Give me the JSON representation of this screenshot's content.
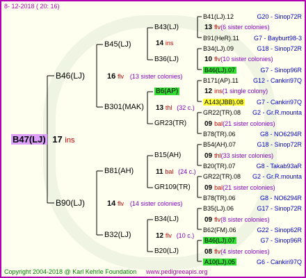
{
  "timestamp": "8- 12-2018 ( 20: 16)",
  "footer": {
    "copyright": "Copyright 2004-2018 @ Karl Kehrle Foundation",
    "url": "www.pedigreeapis.org"
  },
  "root": {
    "label": "B47(LJ)",
    "num": "17",
    "tag": "ins"
  },
  "g1": [
    {
      "label": "B46(LJ)",
      "num": "16",
      "tag": "flv",
      "note": "(13 sister colonies)"
    },
    {
      "label": "B90(LJ)",
      "num": "14",
      "tag": "flv",
      "note": "(14 sister colonies)"
    }
  ],
  "g2": [
    {
      "label": "B45(LJ)"
    },
    {
      "label": "B301(MAK)",
      "num": "13",
      "tag": "thl",
      "note": "(32 c.)"
    },
    {
      "label": "B81(AH)",
      "num": "11",
      "tag": "bal",
      "note": "(24 c.)"
    },
    {
      "label": "B32(LJ)",
      "num": "12",
      "tag": "flv",
      "note": "(10 c.)"
    }
  ],
  "g3": [
    {
      "label": "B43(LJ)",
      "num": "14",
      "tag": "ins"
    },
    {
      "label": "B36(LJ)"
    },
    {
      "label": "B6(AP)"
    },
    {
      "label": "GR23(TR)"
    },
    {
      "label": "B15(AH)"
    },
    {
      "label": "GR109(TR)"
    },
    {
      "label": "B34(LJ)"
    },
    {
      "label": "B20(LJ)"
    }
  ],
  "g4": [
    {
      "label": "B41(LJ).12",
      "right": "G20 - Sinop72R"
    },
    {
      "num": "13",
      "tag": "flv",
      "note": "(6 sister colonies)"
    },
    {
      "label": "B91(HeR).11",
      "right": "G7 - Bayburt98-3"
    },
    {
      "label": "B34(LJ).09",
      "right": "G18 - Sinop72R"
    },
    {
      "num": "10",
      "tag": "flv",
      "note": "(10 sister colonies)"
    },
    {
      "label": "B46(LJ).07",
      "right": "G7 - Sinop96R"
    },
    {
      "label": "B171(AP).11",
      "right": "G12 - Cankiri97Q"
    },
    {
      "num": "12",
      "tag": "ins",
      "note": "(1 single colony)"
    },
    {
      "label": "A143(JBB).08",
      "right": "G7 - Cankiri97Q"
    },
    {
      "label": "GR22(TR).08",
      "right": "G2 - Gr.R.mounta"
    },
    {
      "num": "09",
      "tag": "bal",
      "note": "(21 sister colonies)"
    },
    {
      "label": "B78(TR).06",
      "right": "G8 - NO6294R"
    },
    {
      "label": "B54(AH).07",
      "right": "G18 - Sinop72R"
    },
    {
      "num": "09",
      "tag": "thl",
      "note": "(33 sister colonies)"
    },
    {
      "label": "B20(TR).07",
      "right": "G8 - Takab93aR"
    },
    {
      "label": "GR22(TR).08",
      "right": "G2 - Gr.R.mounta"
    },
    {
      "num": "09",
      "tag": "bal",
      "note": "(21 sister colonies)"
    },
    {
      "label": "B78(TR).06",
      "right": "G8 - NO6294R"
    },
    {
      "label": "B35(LJ).06",
      "right": "G17 - Sinop72R"
    },
    {
      "num": "09",
      "tag": "flv",
      "note": "(8 sister colonies)"
    },
    {
      "label": "B62(FM).06",
      "right": "G22 - Sinop62R"
    },
    {
      "label": "B46(LJ).07",
      "right": "G7 - Sinop96R"
    },
    {
      "num": "08",
      "tag": "flv",
      "note": "(4 sister colonies)"
    },
    {
      "label": "A10(LJ).05",
      "right": "G6 - Cankiri97Q"
    }
  ],
  "colors": {
    "border": "#b000b0",
    "background": "#fffff0",
    "highlight_green": "#33dd33",
    "highlight_yellow": "#ffff33",
    "highlight_root": "#dda0ff"
  }
}
